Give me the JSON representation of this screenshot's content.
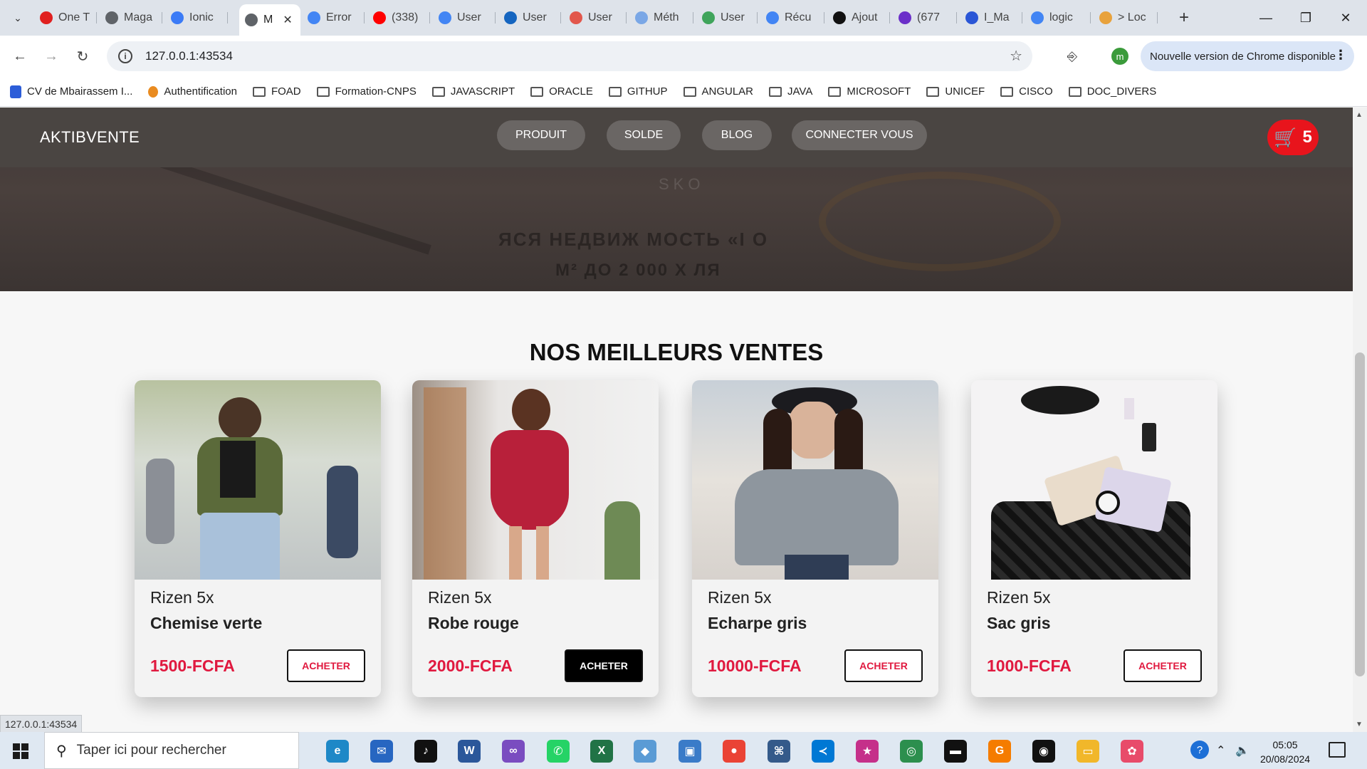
{
  "browser": {
    "tabs": [
      {
        "label": "One T",
        "color": "#e02020"
      },
      {
        "label": "Maga",
        "color": "#5f6368"
      },
      {
        "label": "Ionic",
        "color": "#3b7bf6"
      },
      {
        "label": "M",
        "color": "#5f6368",
        "active": true
      },
      {
        "label": "Error",
        "color": "#4285f4"
      },
      {
        "label": "(338)",
        "color": "#ff0000"
      },
      {
        "label": "User",
        "color": "#4285f4"
      },
      {
        "label": "User",
        "color": "#1565c0"
      },
      {
        "label": "User",
        "color": "#e2574c"
      },
      {
        "label": "Méth",
        "color": "#7aa7e6"
      },
      {
        "label": "User",
        "color": "#3fa45b"
      },
      {
        "label": "Récu",
        "color": "#4285f4"
      },
      {
        "label": "Ajout",
        "color": "#111111"
      },
      {
        "label": "(677",
        "color": "#6b2fc9"
      },
      {
        "label": "I_Ma",
        "color": "#2a56d6"
      },
      {
        "label": "logic",
        "color": "#4285f4"
      },
      {
        "label": "> Loc",
        "color": "#e8a23c"
      }
    ],
    "url": "127.0.0.1:43534",
    "update_label": "Nouvelle version de Chrome disponible",
    "profile_initial": "m",
    "bookmarks": [
      {
        "label": "CV de Mbairassem I...",
        "icon": "doc"
      },
      {
        "label": "Authentification",
        "icon": "fp"
      },
      {
        "label": "FOAD",
        "icon": "folder"
      },
      {
        "label": "Formation-CNPS",
        "icon": "folder"
      },
      {
        "label": "JAVASCRIPT",
        "icon": "folder"
      },
      {
        "label": "ORACLE",
        "icon": "folder"
      },
      {
        "label": "GITHUP",
        "icon": "folder"
      },
      {
        "label": "ANGULAR",
        "icon": "folder"
      },
      {
        "label": "JAVA",
        "icon": "folder"
      },
      {
        "label": "MICROSOFT",
        "icon": "folder"
      },
      {
        "label": "UNICEF",
        "icon": "folder"
      },
      {
        "label": "CISCO",
        "icon": "folder"
      },
      {
        "label": "DOC_DIVERS",
        "icon": "folder"
      }
    ],
    "status_url": "127.0.0.1:43534"
  },
  "site": {
    "brand": "AKTIBVENTE",
    "nav": [
      "PRODUIT",
      "SOLDE",
      "BLOG",
      "CONNECTER VOUS"
    ],
    "cart_count": "5",
    "hero_logo": "SKO",
    "hero_line1": "ЯСЯ НЕДВИЖ  МОСТЬ «І  О",
    "hero_line2": "М² ДО 2 000 Х  ЛЯ",
    "section_title": "NOS MEILLEURS VENTES",
    "products": [
      {
        "subtitle": "Rizen 5x",
        "name": "Chemise verte",
        "price": "1500-FCFA",
        "button": "ACHETER",
        "button_dark": false
      },
      {
        "subtitle": "Rizen 5x",
        "name": "Robe rouge",
        "price": "2000-FCFA",
        "button": "ACHETER",
        "button_dark": true
      },
      {
        "subtitle": "Rizen 5x",
        "name": "Echarpe gris",
        "price": "10000-FCFA",
        "button": "ACHETER",
        "button_dark": false
      },
      {
        "subtitle": "Rizen 5x",
        "name": "Sac gris",
        "price": "1000-FCFA",
        "button": "ACHETER",
        "button_dark": false
      }
    ]
  },
  "taskbar": {
    "search_placeholder": "Taper ici pour rechercher",
    "time": "05:05",
    "date": "20/08/2024",
    "apps": [
      {
        "name": "edge",
        "color": "#1e88c7",
        "glyph": "e"
      },
      {
        "name": "mail",
        "color": "#2766c1",
        "glyph": "✉"
      },
      {
        "name": "tiktok",
        "color": "#111111",
        "glyph": "♪"
      },
      {
        "name": "word",
        "color": "#2b579a",
        "glyph": "W"
      },
      {
        "name": "visual-studio",
        "color": "#7a4cc0",
        "glyph": "∞"
      },
      {
        "name": "whatsapp",
        "color": "#25d366",
        "glyph": "✆"
      },
      {
        "name": "excel",
        "color": "#217346",
        "glyph": "X"
      },
      {
        "name": "app-blue",
        "color": "#5a9bd5",
        "glyph": "◆"
      },
      {
        "name": "app-screen",
        "color": "#3a7bc8",
        "glyph": "▣"
      },
      {
        "name": "chrome",
        "color": "#ea4335",
        "glyph": "●"
      },
      {
        "name": "sql-server",
        "color": "#345a8a",
        "glyph": "⌘"
      },
      {
        "name": "vscode",
        "color": "#0078d4",
        "glyph": "≺"
      },
      {
        "name": "app-star",
        "color": "#c5308a",
        "glyph": "★"
      },
      {
        "name": "globe",
        "color": "#2c8f4e",
        "glyph": "◎"
      },
      {
        "name": "terminal",
        "color": "#111111",
        "glyph": "▬"
      },
      {
        "name": "app-orange",
        "color": "#f57c00",
        "glyph": "G"
      },
      {
        "name": "github",
        "color": "#111111",
        "glyph": "◉"
      },
      {
        "name": "explorer",
        "color": "#f1b72a",
        "glyph": "▭"
      },
      {
        "name": "app-pink",
        "color": "#e84b6a",
        "glyph": "✿"
      }
    ]
  }
}
